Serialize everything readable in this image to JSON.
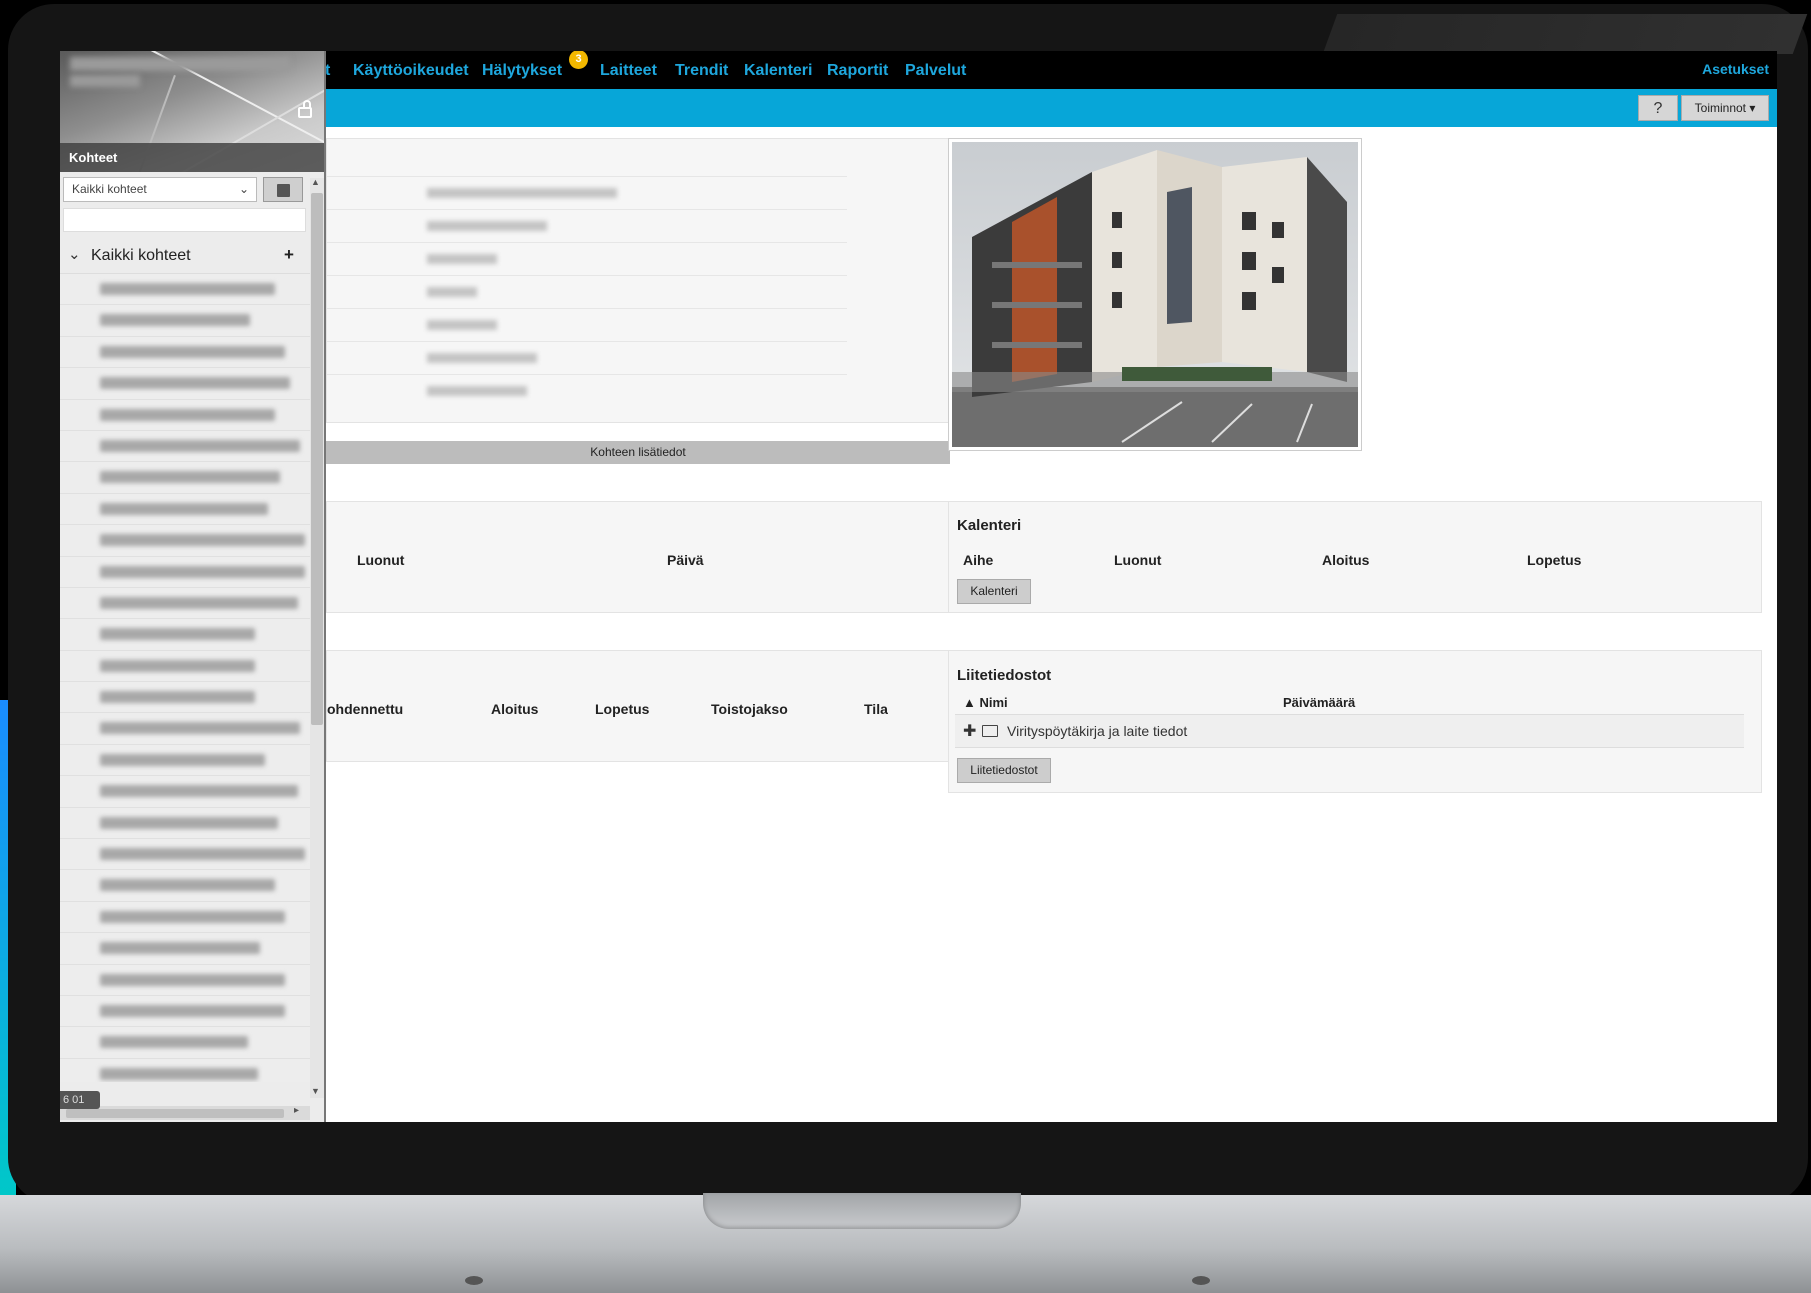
{
  "topnav": {
    "items": [
      "t",
      "Käyttöoikeudet",
      "Hälytykset",
      "Laitteet",
      "Trendit",
      "Kalenteri",
      "Raportit",
      "Palvelut"
    ],
    "alerts_badge": "3",
    "settings_label": "Asetukset"
  },
  "toolbar": {
    "help_label": "?",
    "actions_label": "Toiminnot ▾"
  },
  "sidebar": {
    "header_label": "Kohteet",
    "filter_value": "Kaikki kohteet",
    "tree_root_label": "Kaikki kohteet",
    "corner_tag": "6 01"
  },
  "details": {
    "more_info_label": "Kohteen lisätiedot"
  },
  "left_table_1": {
    "columns": [
      "Luonut",
      "Päivä"
    ]
  },
  "left_table_2": {
    "columns": [
      "ohdennettu",
      "Aloitus",
      "Lopetus",
      "Toistojakso",
      "Tila"
    ]
  },
  "calendar": {
    "title": "Kalenteri",
    "columns": [
      "Aihe",
      "Luonut",
      "Aloitus",
      "Lopetus"
    ],
    "button_label": "Kalenteri"
  },
  "attachments": {
    "title": "Liitetiedostot",
    "columns": [
      "▲ Nimi",
      "Päivämäärä"
    ],
    "rows": [
      {
        "name": "Virityspöytäkirja ja laite tiedot"
      }
    ],
    "button_label": "Liitetiedostot"
  },
  "colors": {
    "accent_blue": "#07a6d8",
    "nav_text": "#1ea7dd",
    "badge": "#f3b800"
  }
}
